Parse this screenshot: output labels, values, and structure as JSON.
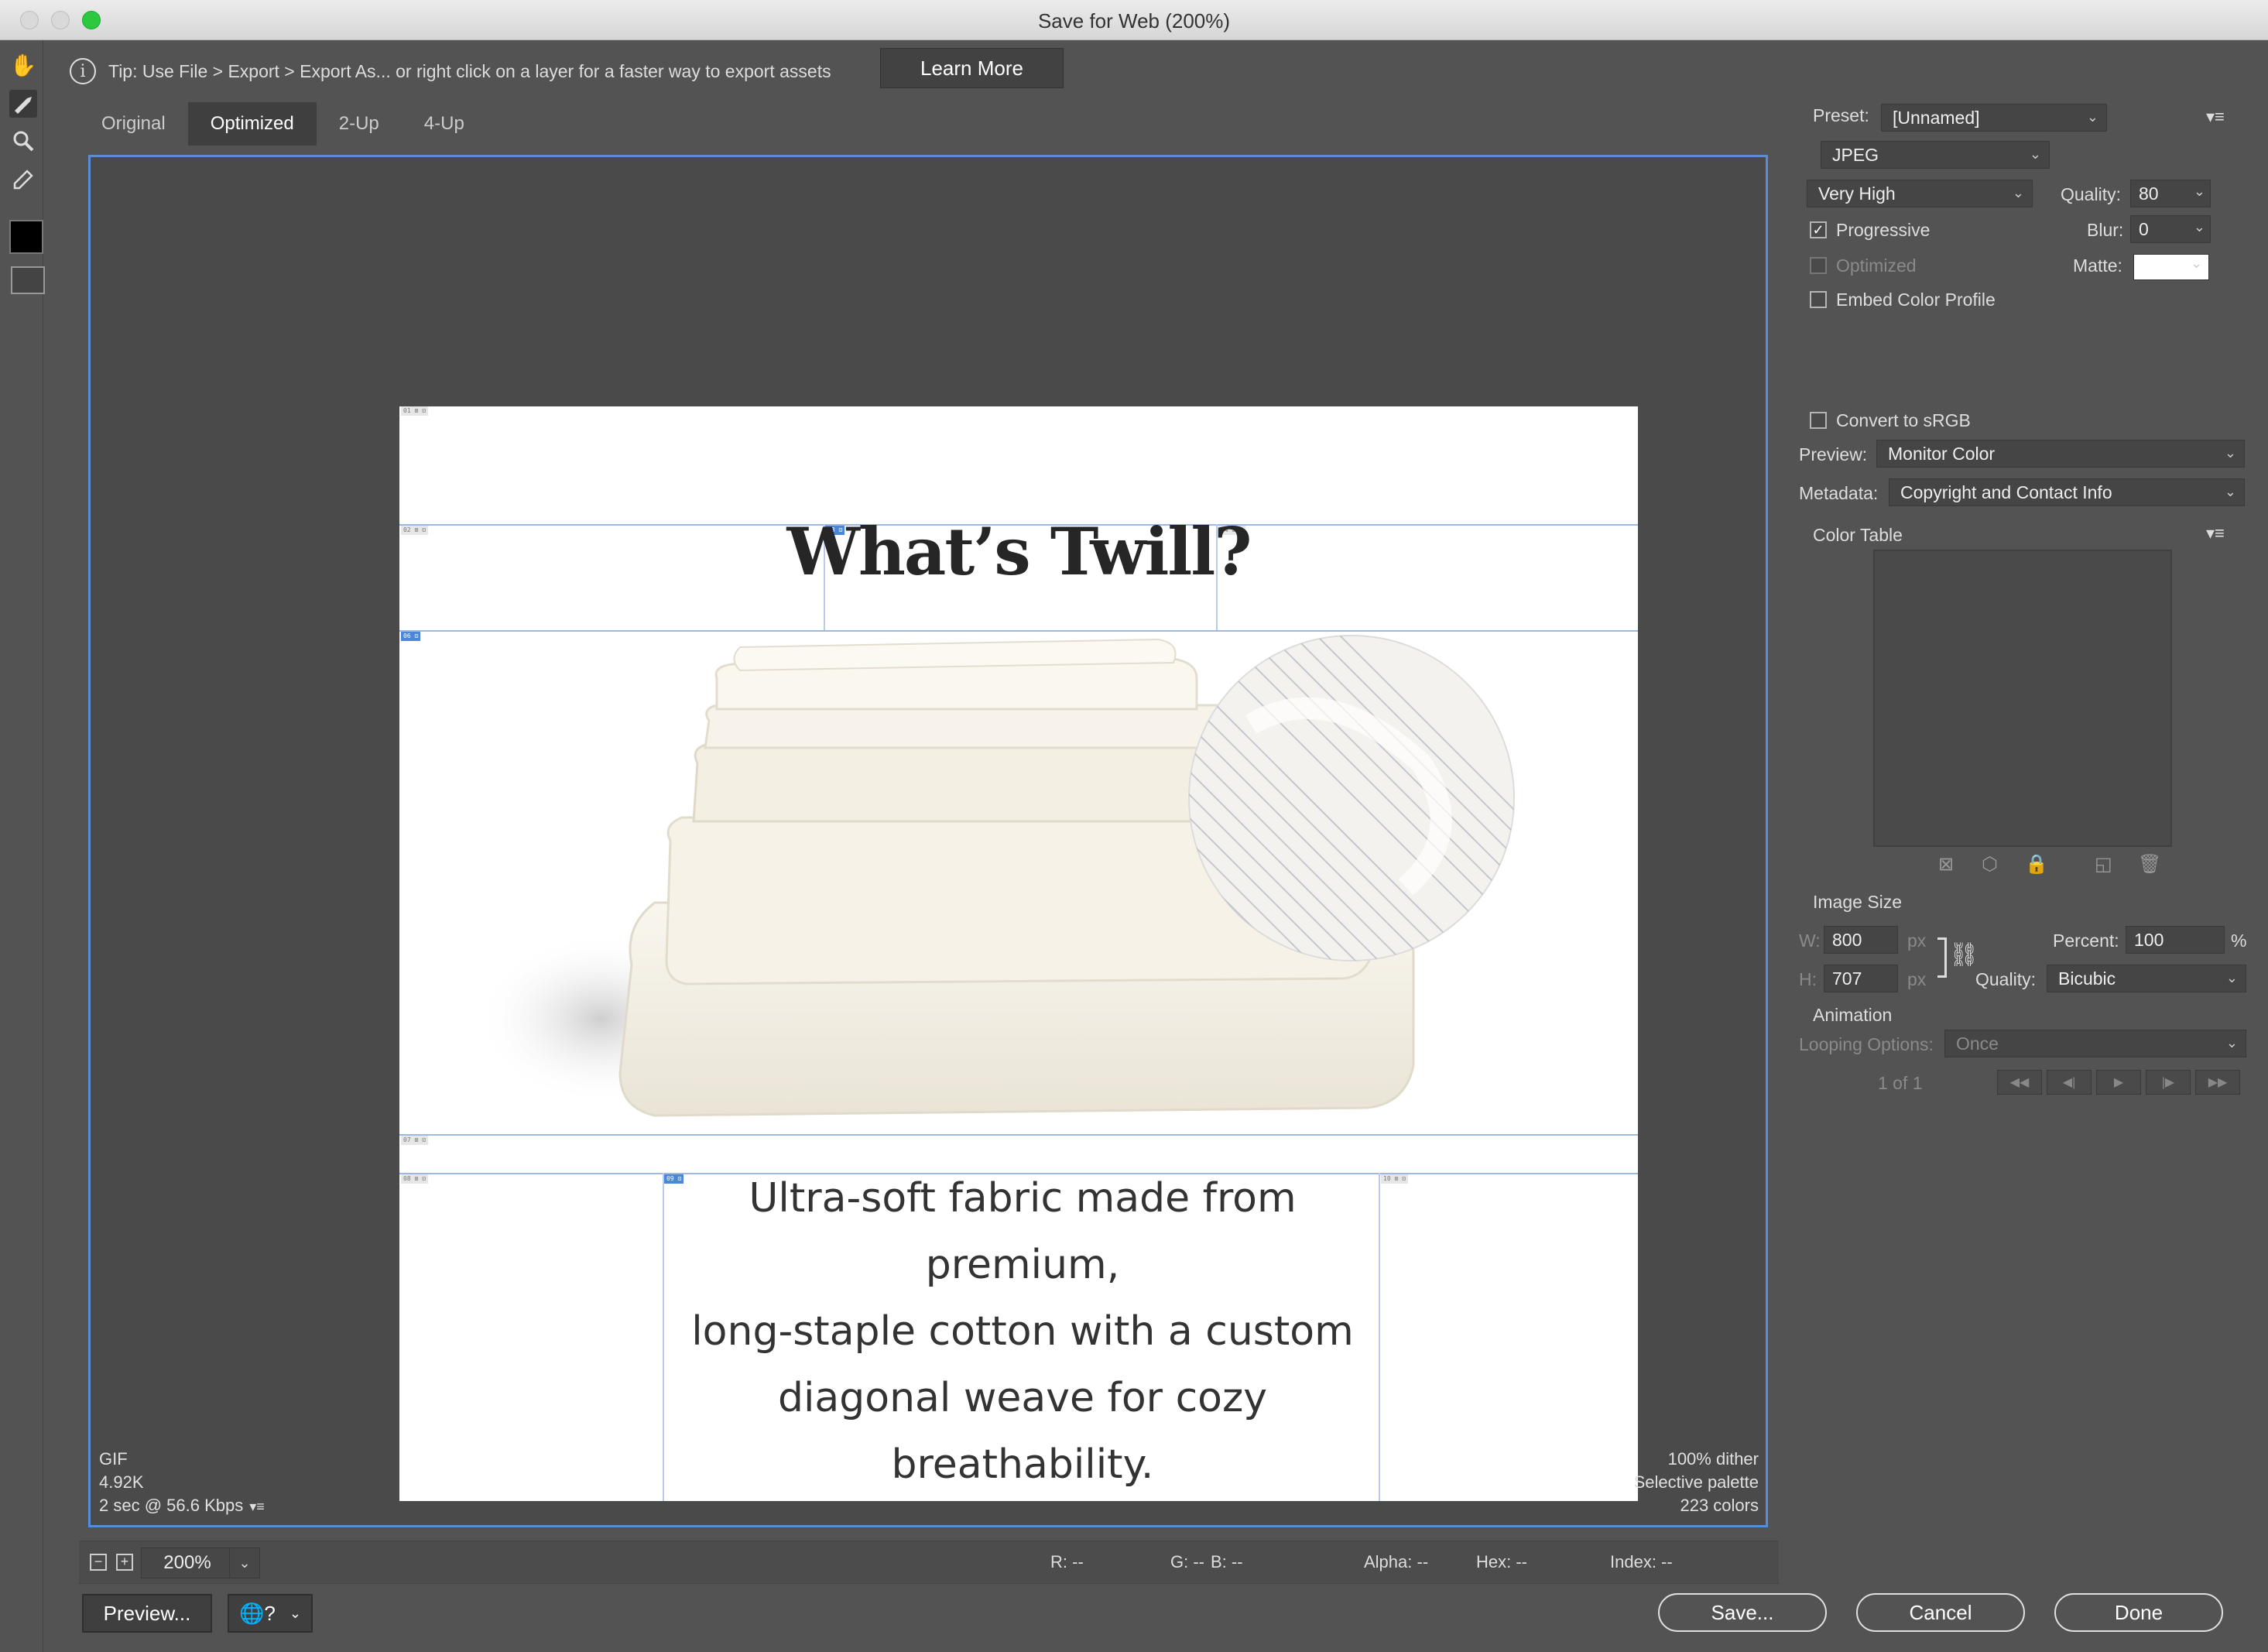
{
  "window": {
    "title": "Save for Web (200%)"
  },
  "tip": {
    "text": "Tip: Use File > Export > Export As...  or right click on a layer for a faster way to export assets",
    "learn_more": "Learn More"
  },
  "tabs": [
    {
      "label": "Original"
    },
    {
      "label": "Optimized",
      "active": true
    },
    {
      "label": "2-Up"
    },
    {
      "label": "4-Up"
    }
  ],
  "canvas": {
    "headline": "What’s Twill?",
    "body_lines": [
      "Ultra-soft fabric made from premium,",
      "long-staple cotton with a custom",
      "diagonal weave for cozy breathability."
    ]
  },
  "preview_info": {
    "format": "GIF",
    "size": "4.92K",
    "download": "2 sec @ 56.6 Kbps",
    "dither": "100% dither",
    "palette": "Selective palette",
    "colors": "223 colors"
  },
  "bottom_bar": {
    "zoom": "200%",
    "r": "R: --",
    "g": "G: --",
    "b": "B: --",
    "alpha": "Alpha: --",
    "hex": "Hex: --",
    "index": "Index: --"
  },
  "buttons": {
    "preview": "Preview...",
    "save": "Save...",
    "cancel": "Cancel",
    "done": "Done"
  },
  "settings": {
    "preset_label": "Preset:",
    "preset_value": "[Unnamed]",
    "format": "JPEG",
    "compression": "Very High",
    "quality_label": "Quality:",
    "quality_value": "80",
    "progressive_label": "Progressive",
    "progressive_checked": true,
    "blur_label": "Blur:",
    "blur_value": "0",
    "optimized_label": "Optimized",
    "matte_label": "Matte:",
    "matte_color": "#ffffff",
    "embed_label": "Embed Color Profile",
    "convert_label": "Convert to sRGB",
    "preview_label": "Preview:",
    "preview_value": "Monitor Color",
    "metadata_label": "Metadata:",
    "metadata_value": "Copyright and Contact Info",
    "color_table_label": "Color Table"
  },
  "image_size": {
    "heading": "Image Size",
    "w_label": "W:",
    "w_value": "800",
    "h_label": "H:",
    "h_value": "707",
    "px": "px",
    "percent_label": "Percent:",
    "percent_value": "100",
    "percent_unit": "%",
    "quality_label": "Quality:",
    "quality_value": "Bicubic"
  },
  "animation": {
    "heading": "Animation",
    "looping_label": "Looping Options:",
    "looping_value": "Once",
    "frame": "1 of 1"
  },
  "colors": {
    "accent": "#5a8bd6",
    "window_bg": "#535353",
    "maximize_green": "#2bc840"
  }
}
